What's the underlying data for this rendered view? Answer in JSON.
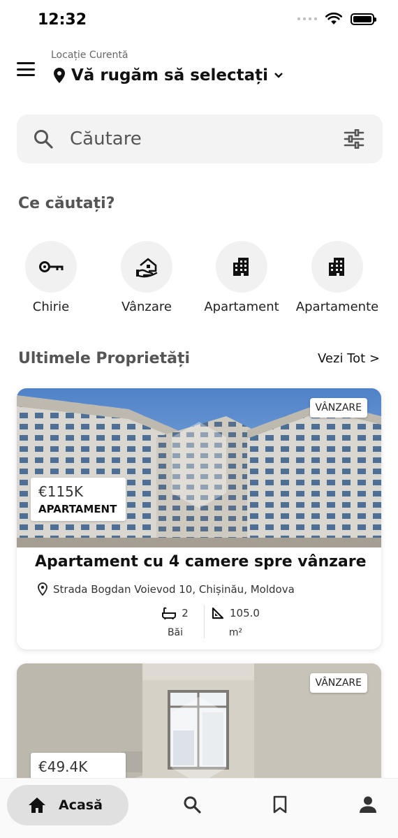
{
  "status_bar": {
    "time": "12:32"
  },
  "header": {
    "location_caption": "Locație Curentă",
    "location_value": "Vă rugăm să selectați"
  },
  "search": {
    "placeholder": "Căutare"
  },
  "categories_section": {
    "title": "Ce căutați?",
    "items": [
      {
        "label": "Chirie",
        "icon": "key-icon"
      },
      {
        "label": "Vânzare",
        "icon": "house-hand-icon"
      },
      {
        "label": "Apartament",
        "icon": "building-icon"
      },
      {
        "label": "Apartamente",
        "icon": "building-icon"
      }
    ]
  },
  "latest_section": {
    "title": "Ultimele Proprietăți",
    "see_all": "Vezi Tot >"
  },
  "properties": [
    {
      "badge": "VÂNZARE",
      "price": "€115K",
      "type": "APARTAMENT",
      "title": "Apartament cu 4 camere spre vânzare",
      "address": "Strada Bogdan Voievod 10, Chișinău, Moldova",
      "baths": "2",
      "baths_label": "Băi",
      "area": "105.0",
      "area_unit": "m²"
    },
    {
      "badge": "VÂNZARE",
      "price": "€49.4K"
    }
  ],
  "bottom_nav": {
    "home_label": "Acasă"
  },
  "colors": {
    "accent_bg": "#e0e0e0",
    "search_bg": "#f3f3f3",
    "circle_bg": "#f1f1f1"
  }
}
